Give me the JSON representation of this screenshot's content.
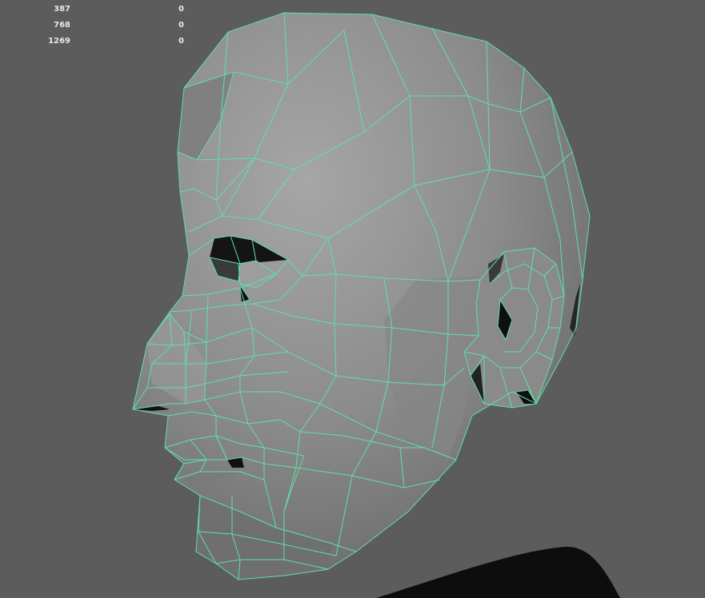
{
  "hud": {
    "rows": [
      {
        "a": "387",
        "b": "0"
      },
      {
        "a": "768",
        "b": "0"
      },
      {
        "a": "1269",
        "b": "0"
      }
    ]
  },
  "colors": {
    "background": "#5c5c5c",
    "wireframe": "#5fe0a8",
    "mesh_light": "#a3a3a3",
    "mesh_dark": "#6e6e6e",
    "shadow": "#111111"
  },
  "scene": {
    "object": "head-mesh",
    "display": "wireframe-on-shaded"
  }
}
